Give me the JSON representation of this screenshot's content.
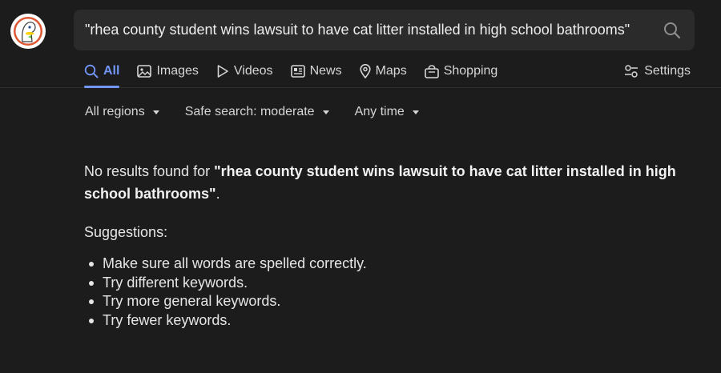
{
  "search": {
    "query": "\"rhea county student wins lawsuit to have cat litter installed in high school bathrooms\""
  },
  "tabs": [
    {
      "label": "All",
      "icon": "search-icon",
      "active": true
    },
    {
      "label": "Images",
      "icon": "image-icon"
    },
    {
      "label": "Videos",
      "icon": "play-icon"
    },
    {
      "label": "News",
      "icon": "newspaper-icon"
    },
    {
      "label": "Maps",
      "icon": "map-pin-icon"
    },
    {
      "label": "Shopping",
      "icon": "shopping-bag-icon"
    }
  ],
  "settings": {
    "label": "Settings",
    "icon": "sliders-icon"
  },
  "filters": {
    "region": "All regions",
    "safe_search": "Safe search: moderate",
    "time": "Any time"
  },
  "results": {
    "no_results_prefix": "No results found for ",
    "no_results_query": "\"rhea county student wins lawsuit to have cat litter installed in high school bathrooms\"",
    "no_results_suffix": ".",
    "suggestions_title": "Suggestions:",
    "suggestions": [
      "Make sure all words are spelled correctly.",
      "Try different keywords.",
      "Try more general keywords.",
      "Try fewer keywords."
    ]
  },
  "colors": {
    "background": "#1c1c1c",
    "search_bg": "#2b2b2b",
    "accent": "#7295f6"
  }
}
